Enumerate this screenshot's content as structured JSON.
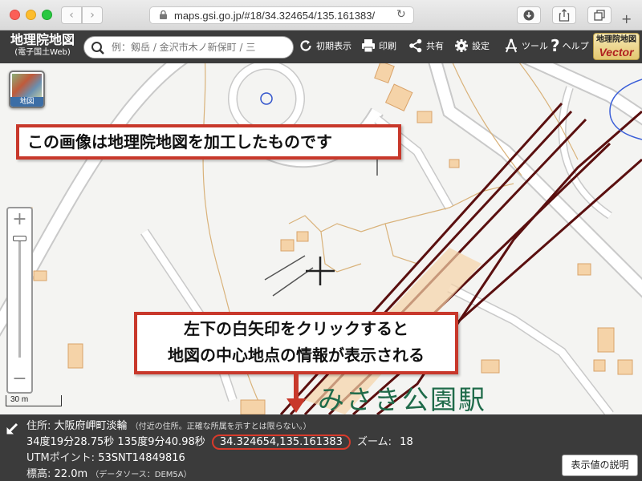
{
  "browser": {
    "url": "maps.gsi.go.jp/#18/34.324654/135.161383/",
    "icons": [
      "back-icon",
      "forward-icon",
      "lock-icon",
      "reload-icon",
      "download-icon",
      "share-icon",
      "tabs-icon",
      "new-tab-icon"
    ]
  },
  "app": {
    "logo_main": "地理院地図",
    "logo_sub": "(電子国土Web)",
    "search_placeholder": "例：剱岳 / 金沢市木ノ新保町 / 三",
    "tools": {
      "init": "初期表示",
      "print": "印刷",
      "share": "共有",
      "settings": "設定",
      "tool": "ツール",
      "help": "ヘルプ"
    },
    "vector_logo_top": "地理院地図",
    "vector_logo_bottom": "Vector"
  },
  "map": {
    "layer_label": "地図",
    "zoom_plus": "+",
    "zoom_minus": "−",
    "scale_label": "30 m",
    "station_label": "みさき公園駅",
    "colors": {
      "railway": "#5a0f0f",
      "building": "#f5d3a8",
      "contour": "#d9b27a",
      "callout_border": "#c8382b"
    }
  },
  "callouts": {
    "top": "この画像は地理院地図を加工したものです",
    "bottom_line1": "左下の白矢印をクリックすると",
    "bottom_line2": "地図の中心地点の情報が表示される"
  },
  "info": {
    "address_label": "住所:",
    "address_value": "大阪府岬町淡輪",
    "address_note": "（付近の住所。正確な所属を示すとは限らない。）",
    "dms": "34度19分28.75秒 135度9分40.98秒",
    "decimal": "34.324654,135.161383",
    "zoom_label": "ズーム:",
    "zoom_value": "18",
    "utm_label": "UTMポイント:",
    "utm_value": "53SNT14849816",
    "elev_label": "標高:",
    "elev_value": "22.0m",
    "elev_note": "（データソース：DEM5A）",
    "explain_button": "表示値の説明"
  }
}
